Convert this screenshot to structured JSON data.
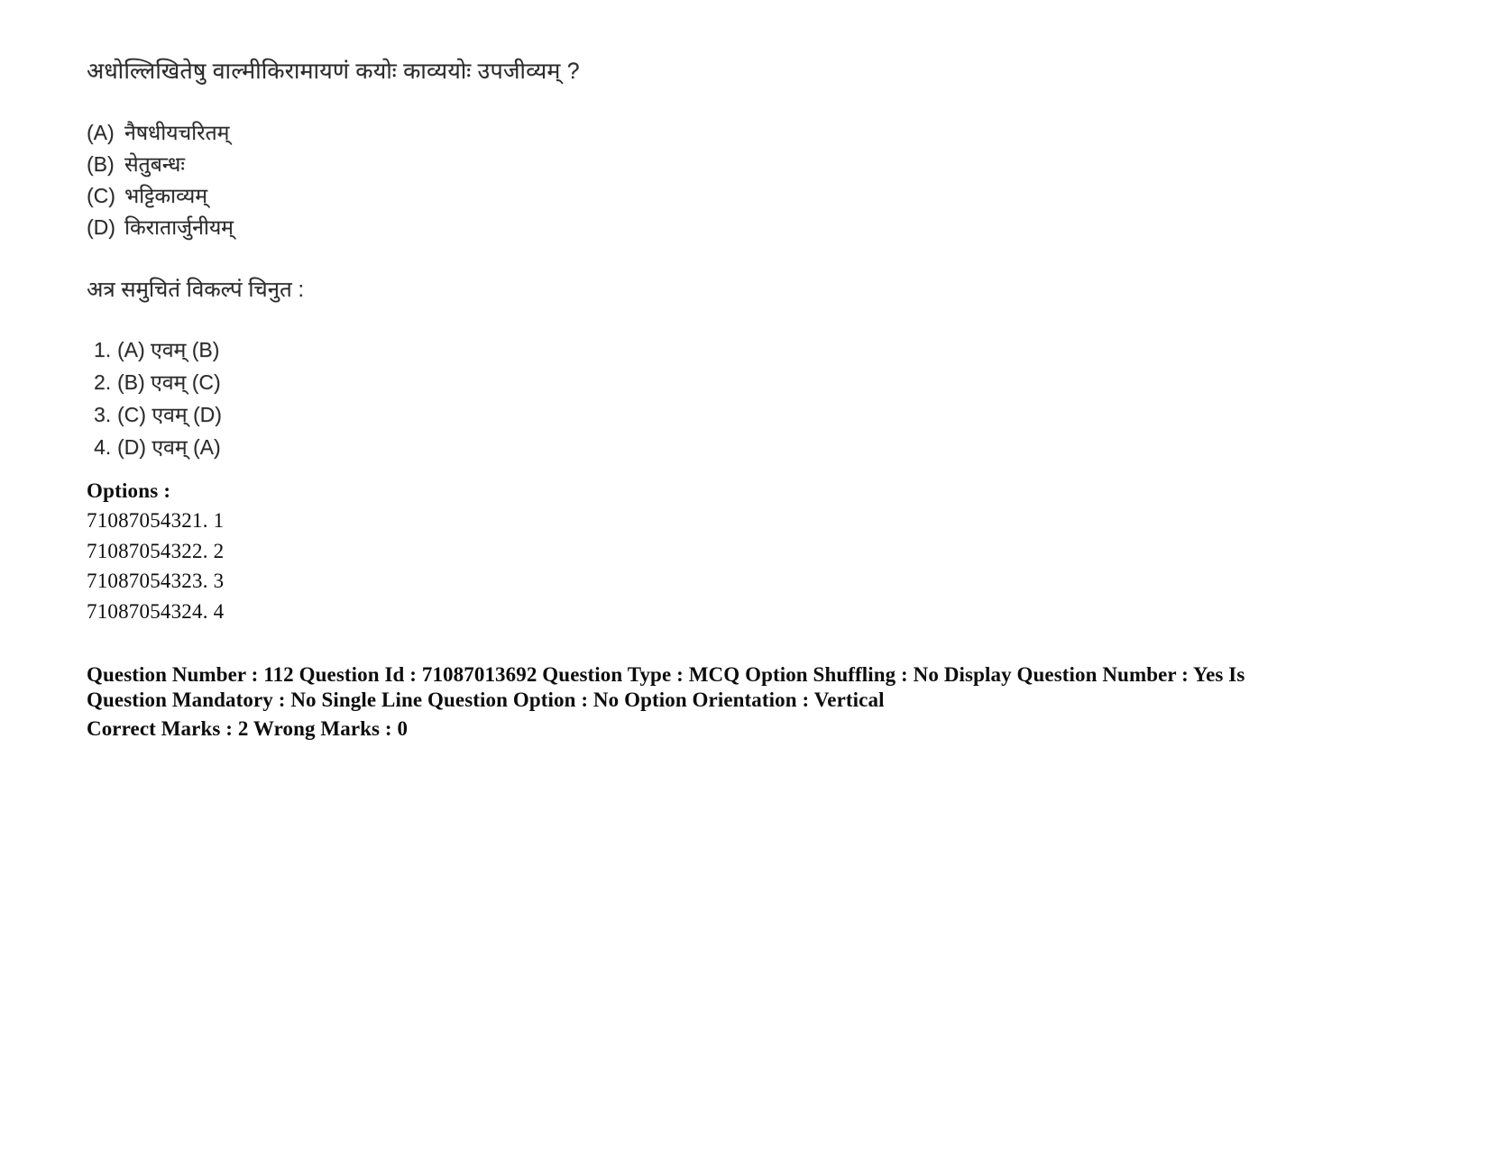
{
  "question": {
    "stem": "अधोल्लिखितेषु वाल्मीकिरामायणं कयोः काव्ययोः उपजीव्यम् ?",
    "lettered_options": [
      {
        "label": "(A)",
        "text": "नैषधीयचरितम्"
      },
      {
        "label": "(B)",
        "text": "सेतुबन्धः"
      },
      {
        "label": "(C)",
        "text": "भट्टिकाव्यम्"
      },
      {
        "label": "(D)",
        "text": "किरातार्जुनीयम्"
      }
    ],
    "instruction": "अत्र समुचितं विकल्पं चिनुत :",
    "numbered_choices": [
      {
        "number": "1.",
        "text": "(A) एवम् (B)"
      },
      {
        "number": "2.",
        "text": "(B) एवम् (C)"
      },
      {
        "number": "3.",
        "text": "(C) एवम् (D)"
      },
      {
        "number": "4.",
        "text": "(D) एवम् (A)"
      }
    ]
  },
  "options_section": {
    "heading": "Options :",
    "entries": [
      "71087054321. 1",
      "71087054322. 2",
      "71087054323. 3",
      "71087054324. 4"
    ]
  },
  "metadata": {
    "line1": "Question Number : 112 Question Id : 71087013692 Question Type : MCQ Option Shuffling : No Display Question Number : Yes Is",
    "line2": "Question Mandatory : No Single Line Question Option : No Option Orientation : Vertical",
    "line3": "Correct Marks : 2 Wrong Marks : 0",
    "fields": {
      "question_number": "112",
      "question_id": "71087013692",
      "question_type": "MCQ",
      "option_shuffling": "No",
      "display_question_number": "Yes",
      "is_question_mandatory": "No",
      "single_line_question_option": "No",
      "option_orientation": "Vertical",
      "correct_marks": "2",
      "wrong_marks": "0"
    }
  }
}
